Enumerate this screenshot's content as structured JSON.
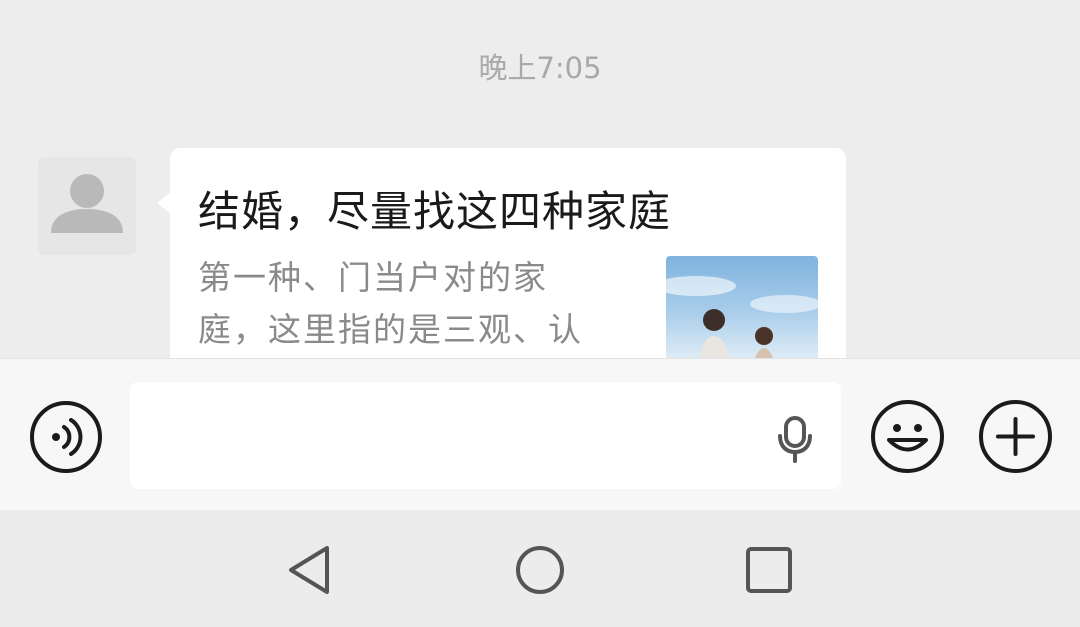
{
  "chat": {
    "timestamp": "晚上7:05",
    "message": {
      "title": "结婚，尽量找这四种家庭",
      "summary_line1": "第一种、门当户对的家",
      "summary_line2": "庭，这里指的是三观、认",
      "thumbnail_icon": "couple-photo",
      "avatar_icon": "default-person-icon"
    }
  },
  "input_bar": {
    "voice_icon": "voice-input-icon",
    "text_placeholder": "",
    "mic_icon": "mic-icon",
    "emoji_icon": "smiley-face-icon",
    "more_icon": "plus-icon"
  },
  "nav_bar": {
    "back_icon": "back-triangle-icon",
    "home_icon": "home-circle-icon",
    "recent_icon": "recent-square-icon"
  },
  "colors": {
    "background": "#ededed",
    "bubble": "#ffffff",
    "timestamp_text": "#a9a9a9",
    "title_text": "#1a1a1a",
    "summary_text": "#8a8a8a",
    "icon_stroke": "#1b1b1b"
  }
}
